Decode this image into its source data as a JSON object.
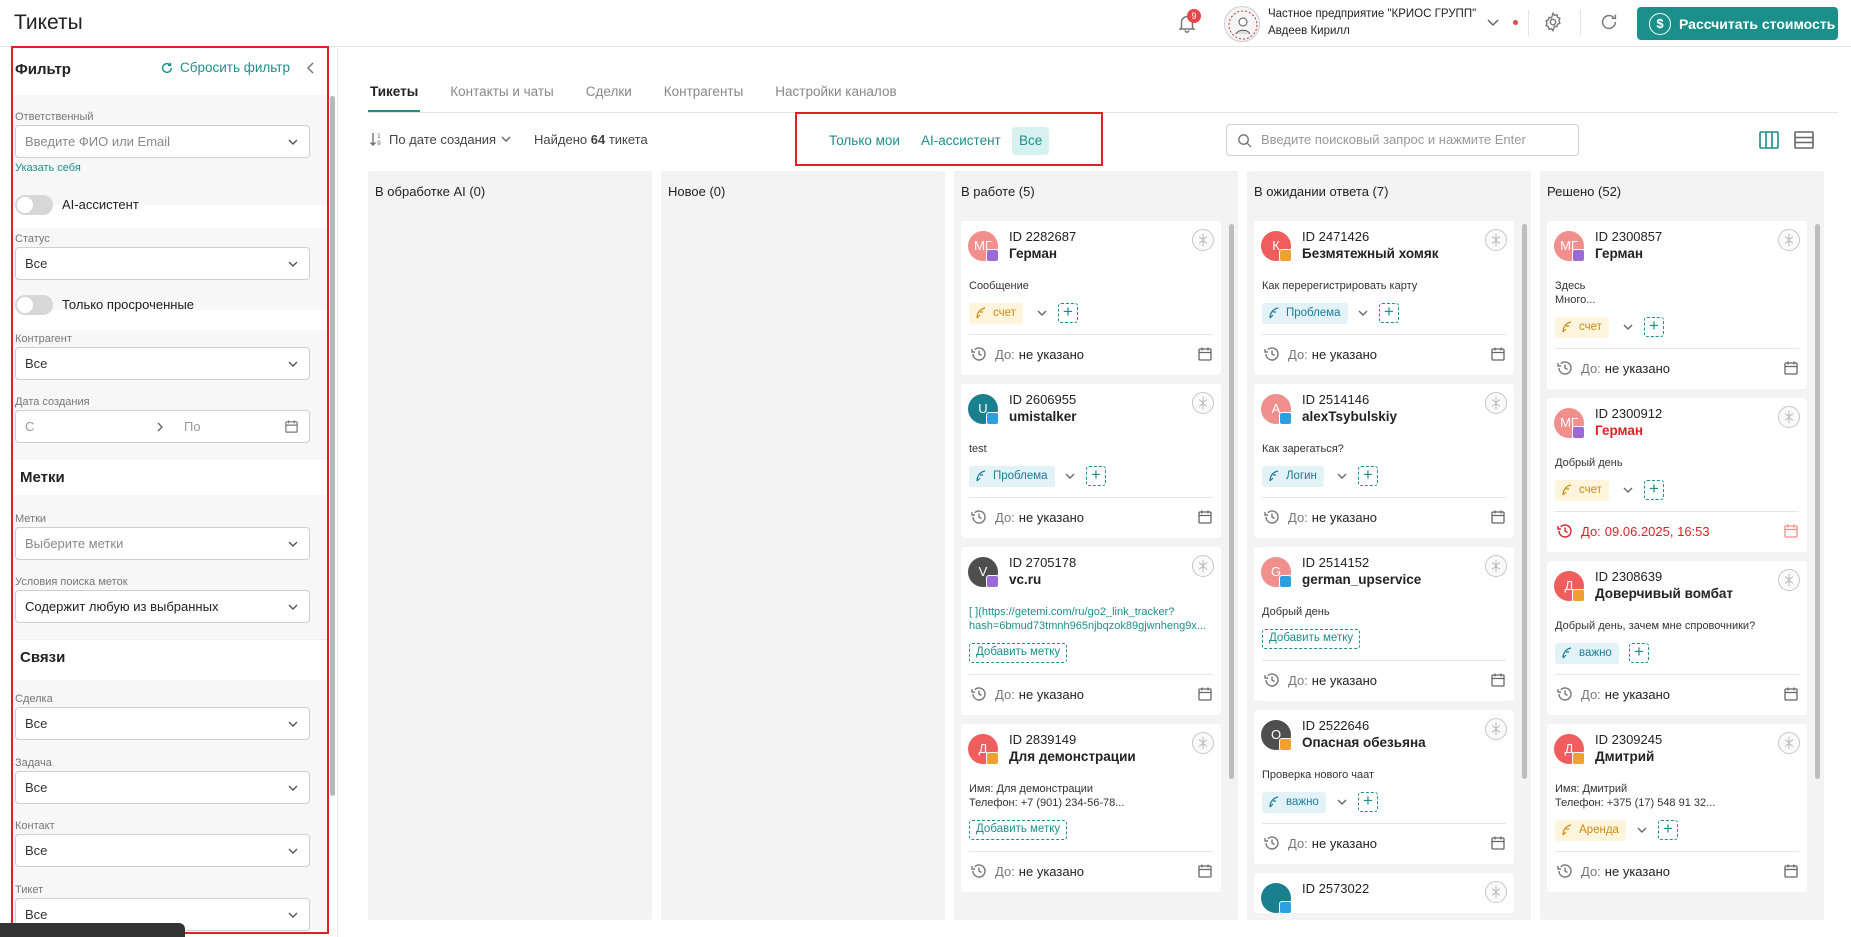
{
  "header": {
    "title": "Тикеты",
    "notification_count": "9",
    "company_name": "Частное предприятие \"КРИОС ГРУПП\"",
    "user_name": "Авдеев Кирилл",
    "calc_button": "Рассчитать стоимость",
    "icons": [
      "bell-icon",
      "chevron-down-icon",
      "gear-icon",
      "refresh-icon",
      "dollar-coin-icon"
    ]
  },
  "filter": {
    "title": "Фильтр",
    "reset": "Сбросить фильтр",
    "responsible_label": "Ответственный",
    "responsible_placeholder": "Введите ФИО или Email",
    "assign_self": "Указать себя",
    "ai_toggle": "AI-ассистент",
    "status_label": "Статус",
    "status_value": "Все",
    "overdue_toggle": "Только просроченные",
    "counterparty_label": "Контрагент",
    "counterparty_value": "Все",
    "created_label": "Дата создания",
    "date_from": "С",
    "date_to": "По",
    "tags_section": "Метки",
    "tags_label": "Метки",
    "tags_placeholder": "Выберите метки",
    "tag_cond_label": "Условия поиска меток",
    "tag_cond_value": "Содержит любую из выбранных",
    "links_section": "Связи",
    "deal_label": "Сделка",
    "deal_value": "Все",
    "task_label": "Задача",
    "task_value": "Все",
    "contact_label": "Контакт",
    "contact_value": "Все",
    "ticket_label": "Тикет",
    "ticket_value": "Все"
  },
  "tabs": [
    "Тикеты",
    "Контакты и чаты",
    "Сделки",
    "Контрагенты",
    "Настройки каналов"
  ],
  "toolbar": {
    "sort": "По дате создания",
    "found_prefix": "Найдено",
    "found_count": "64",
    "found_suffix": "тикета",
    "quick_filters": [
      "Только мои",
      "AI-ассистент",
      "Все"
    ],
    "search_placeholder": "Введите поисковый запрос и нажмите Enter"
  },
  "due_label": "До:",
  "add_tag_label": "Добавить метку",
  "colors": {
    "accent": "#1b8f8a",
    "highlight": "#e01f26"
  },
  "columns": [
    {
      "title": "В обработке AI (0)",
      "cards": []
    },
    {
      "title": "Новое (0)",
      "cards": []
    },
    {
      "title": "В работе (5)",
      "cards": [
        {
          "id": "ID 2282687",
          "name": "Герман",
          "initials": "МГ",
          "avatar_color": "#f08f8b",
          "channel_color": "#9a6bd6",
          "text": [
            "Сообщение"
          ],
          "tag": "счет",
          "tag_style": "yellow",
          "due": "не указано"
        },
        {
          "id": "ID 2606955",
          "name": "umistalker",
          "initials": "U",
          "avatar_color": "#1a7f8e",
          "channel_color": "#2b9fe0",
          "text": [
            "test"
          ],
          "tag": "Проблема",
          "tag_style": "blue",
          "due": "не указано"
        },
        {
          "id": "ID 2705178",
          "name": "vc.ru",
          "initials": "V",
          "avatar_color": "#4e4e4e",
          "channel_color": "#9a6bd6",
          "text": [
            "[  ](https://getemi.com/ru/go2_link_tracker?",
            "hash=6bmud73tmnh965njbqzok89gjwnheng9x..."
          ],
          "link": true,
          "add_tag": true,
          "due": "не указано"
        },
        {
          "id": "ID 2839149",
          "name": "Для демонстрации",
          "initials": "Д",
          "avatar_color": "#ef5d5d",
          "channel_color": "#f0a030",
          "text": [
            "Имя: Для демонстрации",
            "Телефон: +7 (901) 234-56-78..."
          ],
          "add_tag": true,
          "due": "не указано"
        }
      ]
    },
    {
      "title": "В ожидании ответа (7)",
      "cards": [
        {
          "id": "ID 2471426",
          "name": "Безмятежный хомяк",
          "initials": "К",
          "avatar_color": "#ef5d5d",
          "channel_color": "#f0a030",
          "text": [
            "Как перерегистрировать карту"
          ],
          "tag": "Проблема",
          "tag_style": "blue",
          "due": "не указано"
        },
        {
          "id": "ID 2514146",
          "name": "alexTsybulskiy",
          "initials": "A",
          "avatar_color": "#f08f8b",
          "channel_color": "#2b9fe0",
          "text": [
            "Как зарегаться?"
          ],
          "tag": "Логин",
          "tag_style": "blue",
          "due": "не указано"
        },
        {
          "id": "ID 2514152",
          "name": "german_upservice",
          "initials": "G",
          "avatar_color": "#f08f8b",
          "channel_color": "#2b9fe0",
          "text": [
            "Добрый день"
          ],
          "add_tag": true,
          "due": "не указано"
        },
        {
          "id": "ID 2522646",
          "name": "Опасная обезьяна",
          "initials": "О",
          "avatar_color": "#4e4e4e",
          "channel_color": "#f0a030",
          "text": [
            "Проверка нового чаат"
          ],
          "tag": "важно",
          "tag_style": "blue",
          "due": "не указано"
        },
        {
          "id": "ID 2573022",
          "name": "",
          "initials": "",
          "avatar_color": "#1a7f8e",
          "channel_color": "#2b9fe0",
          "text": [],
          "due": ""
        }
      ]
    },
    {
      "title": "Решено (52)",
      "cards": [
        {
          "id": "ID 2300857",
          "name": "Герман",
          "initials": "МГ",
          "avatar_color": "#f08f8b",
          "channel_color": "#9a6bd6",
          "text": [
            "Здесь",
            "Много..."
          ],
          "tag": "счет",
          "tag_style": "yellow",
          "due": "не указано"
        },
        {
          "id": "ID 2300912",
          "name": "Герман",
          "initials": "МГ",
          "avatar_color": "#f08f8b",
          "channel_color": "#9a6bd6",
          "name_red": true,
          "text": [
            "Добрый день"
          ],
          "tag": "счет",
          "tag_style": "yellow",
          "due": "09.06.2025, 16:53",
          "due_red": true
        },
        {
          "id": "ID 2308639",
          "name": "Доверчивый вомбат",
          "initials": "Д",
          "avatar_color": "#ef5d5d",
          "channel_color": "#f0a030",
          "text": [
            "Добрый день, зачем мне спровочники?"
          ],
          "tag": "важно",
          "tag_style": "blue",
          "no_chev": true,
          "due": "не указано"
        },
        {
          "id": "ID 2309245",
          "name": "Дмитрий",
          "initials": "Д",
          "avatar_color": "#ef5d5d",
          "channel_color": "#f0a030",
          "text": [
            "Имя: Дмитрий",
            "Телефон: +375 (17) 548 91 32..."
          ],
          "tag": "Аренда",
          "tag_style": "orange",
          "due": "не указано"
        }
      ]
    }
  ]
}
